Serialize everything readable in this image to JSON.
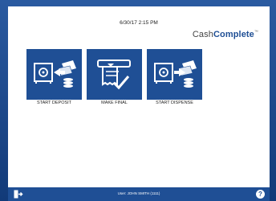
{
  "datetime": "6/30/17 2:15 PM",
  "brand": {
    "prefix": "Cash",
    "bold": "Complete",
    "tm": "™"
  },
  "tiles": [
    {
      "label": "START DEPOSIT",
      "icon": "safe-deposit-icon"
    },
    {
      "label": "MAKE FINAL",
      "icon": "receipt-check-icon"
    },
    {
      "label": "START DISPENSE",
      "icon": "safe-dispense-icon"
    }
  ],
  "status": {
    "user": "User: JOHN SMITH (1111)",
    "help": "?"
  },
  "colors": {
    "accent": "#1f4f95",
    "frame": "#2a5aa0"
  }
}
